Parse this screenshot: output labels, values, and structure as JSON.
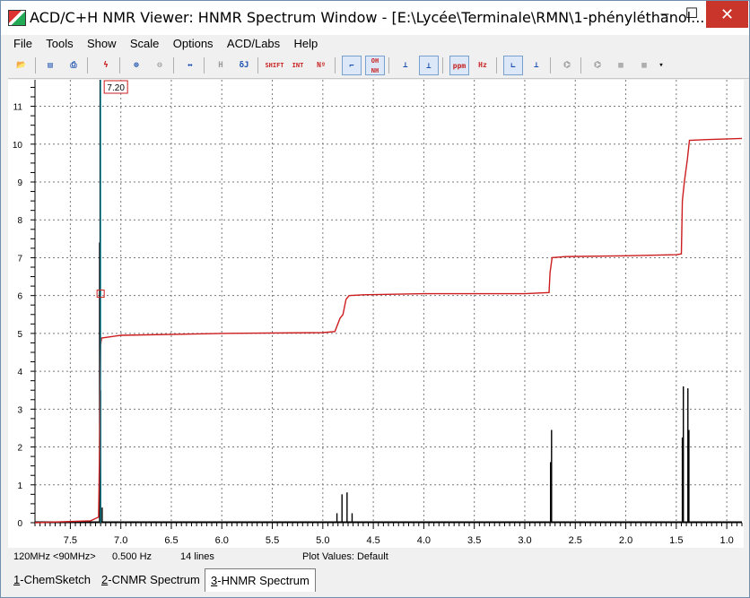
{
  "window": {
    "title": "ACD/C+H NMR Viewer: HNMR Spectrum Window - [E:\\Lycée\\Terminale\\RMN\\1-phényléthanol....",
    "minimize_glyph": "–",
    "maximize_glyph": "☐",
    "close_glyph": "✕"
  },
  "menu": {
    "file": "File",
    "tools": "Tools",
    "show": "Show",
    "scale": "Scale",
    "options": "Options",
    "acdlabs": "ACD/Labs",
    "help": "Help"
  },
  "toolbar": {
    "buttons": [
      {
        "icon": "open-folder-icon",
        "glyph": "📂"
      },
      {
        "icon": "save-icon",
        "glyph": "▤"
      },
      {
        "icon": "print-icon",
        "glyph": "⎙"
      },
      {
        "icon": "lightning-icon",
        "glyph": "ϟ"
      },
      {
        "icon": "zoom-in-icon",
        "glyph": "⊕"
      },
      {
        "icon": "zoom-out-icon",
        "glyph": "⊖"
      },
      {
        "icon": "expand-horizontal-icon",
        "glyph": "↔"
      },
      {
        "icon": "h-peak-icon",
        "glyph": "H"
      },
      {
        "icon": "multiplet-icon",
        "glyph": "δJ"
      },
      {
        "icon": "shift-icon",
        "label": "SHIFT"
      },
      {
        "icon": "integral-icon",
        "label": "INT"
      },
      {
        "icon": "n-hydrogens-icon",
        "label": "Nº"
      },
      {
        "icon": "baseline-icon",
        "glyph": "⌐"
      },
      {
        "icon": "oh-nh-icon",
        "label": "OH NH"
      },
      {
        "icon": "peaks-icon",
        "glyph": "⊥"
      },
      {
        "icon": "peaks-alt-icon",
        "glyph": "⊥"
      },
      {
        "icon": "ppm-icon",
        "label": "ppm"
      },
      {
        "icon": "hz-icon",
        "label": "Hz"
      },
      {
        "icon": "axis-icon",
        "glyph": "∟"
      },
      {
        "icon": "axis-alt-icon",
        "glyph": "⊥"
      },
      {
        "icon": "molecule-icon",
        "glyph": "⌬"
      },
      {
        "icon": "table-icon",
        "glyph": "▦"
      },
      {
        "icon": "table-3d-icon",
        "glyph": "▦"
      },
      {
        "icon": "more-icon",
        "glyph": "▾"
      }
    ]
  },
  "colors": {
    "spectrum": "#000000",
    "integral": "#cc1e1e",
    "cursor": "#0a8ca0",
    "grid": "#7a7a7a",
    "marker": "#cc1e1e"
  },
  "chart_data": {
    "type": "line",
    "x_axis": {
      "range": [
        7.85,
        0.85
      ],
      "reversed": true,
      "ticks": [
        7.5,
        7.0,
        6.5,
        6.0,
        5.5,
        5.0,
        4.5,
        4.0,
        3.5,
        3.0,
        2.5,
        2.0,
        1.5,
        1.0
      ],
      "tick_labels": [
        "7.5",
        "7.0",
        "6.5",
        "6.0",
        "5.5",
        "5.0",
        "4.5",
        "4.0",
        "3.5",
        "3.0",
        "2.5",
        "2.0",
        "1.5",
        "1.0"
      ]
    },
    "y_axis": {
      "range": [
        0,
        11.7
      ],
      "ticks": [
        0,
        1,
        2,
        3,
        4,
        5,
        6,
        7,
        8,
        9,
        10,
        11
      ],
      "tick_labels": [
        "0",
        "1",
        "2",
        "3",
        "4",
        "5",
        "6",
        "7",
        "8",
        "9",
        "10",
        "11"
      ]
    },
    "grid": true,
    "cursor": {
      "x": 7.2,
      "label": "7.20"
    },
    "integral_points": [
      [
        7.85,
        0.0
      ],
      [
        7.3,
        0.05
      ],
      [
        7.22,
        0.15
      ],
      [
        7.21,
        2.0
      ],
      [
        7.2,
        4.7
      ],
      [
        7.19,
        4.88
      ],
      [
        7.0,
        4.95
      ],
      [
        6.0,
        5.0
      ],
      [
        5.0,
        5.02
      ],
      [
        4.88,
        5.05
      ],
      [
        4.83,
        5.4
      ],
      [
        4.8,
        5.5
      ],
      [
        4.77,
        5.9
      ],
      [
        4.74,
        6.0
      ],
      [
        4.6,
        6.02
      ],
      [
        4.0,
        6.05
      ],
      [
        3.0,
        6.05
      ],
      [
        2.76,
        6.08
      ],
      [
        2.75,
        6.6
      ],
      [
        2.73,
        7.0
      ],
      [
        2.6,
        7.03
      ],
      [
        2.0,
        7.05
      ],
      [
        1.5,
        7.08
      ],
      [
        1.45,
        7.1
      ],
      [
        1.44,
        8.5
      ],
      [
        1.42,
        9.0
      ],
      [
        1.39,
        9.6
      ],
      [
        1.37,
        10.1
      ],
      [
        1.2,
        10.12
      ],
      [
        0.85,
        10.15
      ]
    ],
    "peaks": [
      {
        "x": 7.21,
        "height": 7.4
      },
      {
        "x": 7.205,
        "height": 11.7
      },
      {
        "x": 7.2,
        "height": 3.5
      },
      {
        "x": 7.185,
        "height": 0.4
      },
      {
        "x": 4.86,
        "height": 0.25
      },
      {
        "x": 4.81,
        "height": 0.75
      },
      {
        "x": 4.76,
        "height": 0.8
      },
      {
        "x": 4.71,
        "height": 0.25
      },
      {
        "x": 2.745,
        "height": 1.6
      },
      {
        "x": 2.735,
        "height": 2.45
      },
      {
        "x": 1.44,
        "height": 2.25
      },
      {
        "x": 1.43,
        "height": 3.6
      },
      {
        "x": 1.385,
        "height": 3.55
      },
      {
        "x": 1.375,
        "height": 2.45
      }
    ]
  },
  "status": {
    "frequency": "120MHz <90MHz>",
    "resolution": "0.500 Hz",
    "lines": "14 lines",
    "plot_values": "Plot Values: Default"
  },
  "tabs": [
    {
      "hotkey": "1",
      "label": "-ChemSketch"
    },
    {
      "hotkey": "2",
      "label": "-CNMR Spectrum"
    },
    {
      "hotkey": "3",
      "label": "-HNMR Spectrum"
    }
  ]
}
